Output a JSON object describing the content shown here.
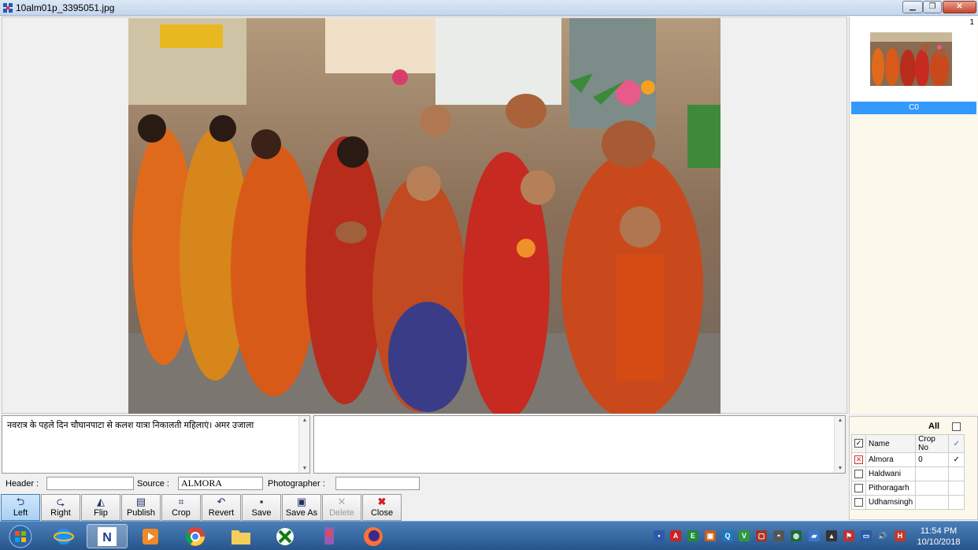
{
  "window": {
    "title": "10alm01p_3395051.jpg"
  },
  "thumbnail": {
    "count": "1",
    "crop_label": "C0"
  },
  "locations": {
    "all_label": "All",
    "headers": {
      "name": "Name",
      "crop_no": "Crop No",
      "check": "✓"
    },
    "rows": [
      {
        "name": "Almora",
        "crop_no": "0",
        "checked": "✓"
      },
      {
        "name": "Haldwani",
        "crop_no": "",
        "checked": ""
      },
      {
        "name": "Pithoragarh",
        "crop_no": "",
        "checked": ""
      },
      {
        "name": "Udhamsingh",
        "crop_no": "",
        "checked": ""
      }
    ]
  },
  "caption": {
    "text": "नवरात्र के पहले दिन चौघानपाटा से कलश यात्रा निकालती महिलाएं। अमर उजाला",
    "secondary": ""
  },
  "fields": {
    "header_label": "Header :",
    "header_value": "",
    "source_label": "Source :",
    "source_value": "ALMORA",
    "photographer_label": "Photographer :",
    "photographer_value": ""
  },
  "toolbar": {
    "left": "Left",
    "right": "Right",
    "flip": "Flip",
    "publish": "Publish",
    "crop": "Crop",
    "revert": "Revert",
    "save": "Save",
    "save_as": "Save As",
    "delete": "Delete",
    "close": "Close"
  },
  "taskbar": {
    "time": "11:54 PM",
    "date": "10/10/2018"
  },
  "colors": {
    "selection": "#3399ff",
    "panel": "#fdf8ec",
    "taskbar": "#27558c"
  }
}
